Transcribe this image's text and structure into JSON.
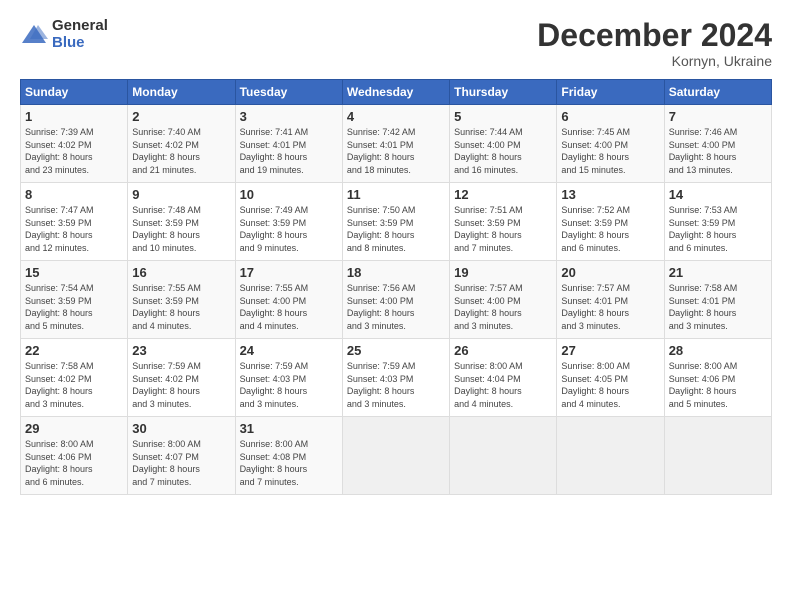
{
  "logo": {
    "general": "General",
    "blue": "Blue"
  },
  "title": "December 2024",
  "location": "Kornyn, Ukraine",
  "days_of_week": [
    "Sunday",
    "Monday",
    "Tuesday",
    "Wednesday",
    "Thursday",
    "Friday",
    "Saturday"
  ],
  "weeks": [
    [
      {
        "num": "1",
        "info": "Sunrise: 7:39 AM\nSunset: 4:02 PM\nDaylight: 8 hours\nand 23 minutes."
      },
      {
        "num": "2",
        "info": "Sunrise: 7:40 AM\nSunset: 4:02 PM\nDaylight: 8 hours\nand 21 minutes."
      },
      {
        "num": "3",
        "info": "Sunrise: 7:41 AM\nSunset: 4:01 PM\nDaylight: 8 hours\nand 19 minutes."
      },
      {
        "num": "4",
        "info": "Sunrise: 7:42 AM\nSunset: 4:01 PM\nDaylight: 8 hours\nand 18 minutes."
      },
      {
        "num": "5",
        "info": "Sunrise: 7:44 AM\nSunset: 4:00 PM\nDaylight: 8 hours\nand 16 minutes."
      },
      {
        "num": "6",
        "info": "Sunrise: 7:45 AM\nSunset: 4:00 PM\nDaylight: 8 hours\nand 15 minutes."
      },
      {
        "num": "7",
        "info": "Sunrise: 7:46 AM\nSunset: 4:00 PM\nDaylight: 8 hours\nand 13 minutes."
      }
    ],
    [
      {
        "num": "8",
        "info": "Sunrise: 7:47 AM\nSunset: 3:59 PM\nDaylight: 8 hours\nand 12 minutes."
      },
      {
        "num": "9",
        "info": "Sunrise: 7:48 AM\nSunset: 3:59 PM\nDaylight: 8 hours\nand 10 minutes."
      },
      {
        "num": "10",
        "info": "Sunrise: 7:49 AM\nSunset: 3:59 PM\nDaylight: 8 hours\nand 9 minutes."
      },
      {
        "num": "11",
        "info": "Sunrise: 7:50 AM\nSunset: 3:59 PM\nDaylight: 8 hours\nand 8 minutes."
      },
      {
        "num": "12",
        "info": "Sunrise: 7:51 AM\nSunset: 3:59 PM\nDaylight: 8 hours\nand 7 minutes."
      },
      {
        "num": "13",
        "info": "Sunrise: 7:52 AM\nSunset: 3:59 PM\nDaylight: 8 hours\nand 6 minutes."
      },
      {
        "num": "14",
        "info": "Sunrise: 7:53 AM\nSunset: 3:59 PM\nDaylight: 8 hours\nand 6 minutes."
      }
    ],
    [
      {
        "num": "15",
        "info": "Sunrise: 7:54 AM\nSunset: 3:59 PM\nDaylight: 8 hours\nand 5 minutes."
      },
      {
        "num": "16",
        "info": "Sunrise: 7:55 AM\nSunset: 3:59 PM\nDaylight: 8 hours\nand 4 minutes."
      },
      {
        "num": "17",
        "info": "Sunrise: 7:55 AM\nSunset: 4:00 PM\nDaylight: 8 hours\nand 4 minutes."
      },
      {
        "num": "18",
        "info": "Sunrise: 7:56 AM\nSunset: 4:00 PM\nDaylight: 8 hours\nand 3 minutes."
      },
      {
        "num": "19",
        "info": "Sunrise: 7:57 AM\nSunset: 4:00 PM\nDaylight: 8 hours\nand 3 minutes."
      },
      {
        "num": "20",
        "info": "Sunrise: 7:57 AM\nSunset: 4:01 PM\nDaylight: 8 hours\nand 3 minutes."
      },
      {
        "num": "21",
        "info": "Sunrise: 7:58 AM\nSunset: 4:01 PM\nDaylight: 8 hours\nand 3 minutes."
      }
    ],
    [
      {
        "num": "22",
        "info": "Sunrise: 7:58 AM\nSunset: 4:02 PM\nDaylight: 8 hours\nand 3 minutes."
      },
      {
        "num": "23",
        "info": "Sunrise: 7:59 AM\nSunset: 4:02 PM\nDaylight: 8 hours\nand 3 minutes."
      },
      {
        "num": "24",
        "info": "Sunrise: 7:59 AM\nSunset: 4:03 PM\nDaylight: 8 hours\nand 3 minutes."
      },
      {
        "num": "25",
        "info": "Sunrise: 7:59 AM\nSunset: 4:03 PM\nDaylight: 8 hours\nand 3 minutes."
      },
      {
        "num": "26",
        "info": "Sunrise: 8:00 AM\nSunset: 4:04 PM\nDaylight: 8 hours\nand 4 minutes."
      },
      {
        "num": "27",
        "info": "Sunrise: 8:00 AM\nSunset: 4:05 PM\nDaylight: 8 hours\nand 4 minutes."
      },
      {
        "num": "28",
        "info": "Sunrise: 8:00 AM\nSunset: 4:06 PM\nDaylight: 8 hours\nand 5 minutes."
      }
    ],
    [
      {
        "num": "29",
        "info": "Sunrise: 8:00 AM\nSunset: 4:06 PM\nDaylight: 8 hours\nand 6 minutes."
      },
      {
        "num": "30",
        "info": "Sunrise: 8:00 AM\nSunset: 4:07 PM\nDaylight: 8 hours\nand 7 minutes."
      },
      {
        "num": "31",
        "info": "Sunrise: 8:00 AM\nSunset: 4:08 PM\nDaylight: 8 hours\nand 7 minutes."
      },
      null,
      null,
      null,
      null
    ]
  ]
}
